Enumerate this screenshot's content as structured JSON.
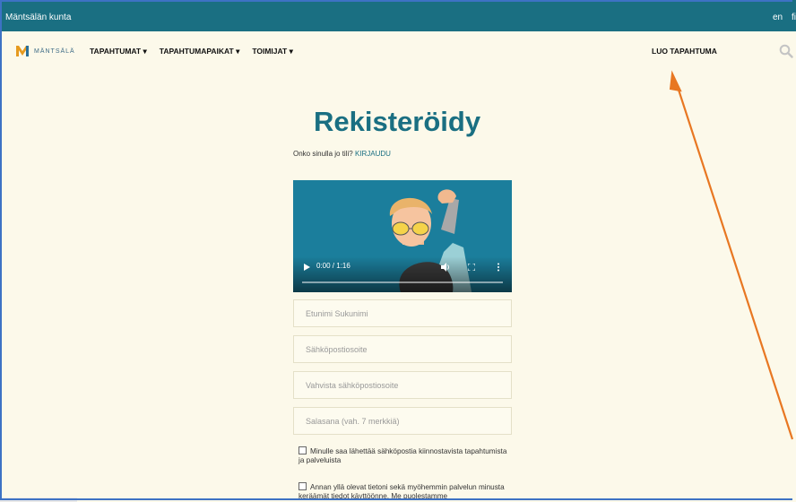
{
  "topbar": {
    "municipality": "Mäntsälän kunta",
    "lang_en": "en",
    "lang_fi": "fi"
  },
  "logo": {
    "text": "MÄNTSÄLÄ"
  },
  "nav": {
    "items": [
      {
        "label": "TAPAHTUMAT ▾"
      },
      {
        "label": "TAPAHTUMAPAIKAT ▾"
      },
      {
        "label": "TOIMIJAT ▾"
      }
    ],
    "create_event": "LUO TAPAHTUMA"
  },
  "page": {
    "title": "Rekisteröidy",
    "login_prompt": "Onko sinulla jo tili?",
    "login_link": "KIRJAUDU"
  },
  "video": {
    "time": "0:00 / 1:16",
    "progress": 0
  },
  "form": {
    "name_placeholder": "Etunimi Sukunimi",
    "email_placeholder": "Sähköpostiosoite",
    "email_confirm_placeholder": "Vahvista sähköpostiosoite",
    "password_placeholder": "Salasana (vah. 7 merkkiä)",
    "consent_marketing": "Minulle saa lähettää sähköpostia kiinnostavista tapahtumista ja palveluista",
    "consent_data": "Annan yllä olevat tietoni sekä myöhemmin palvelun minusta keräämät tiedot käyttöönne. Me puolestamme"
  },
  "colors": {
    "topbar": "#1a6f82",
    "background": "#fcf9ea",
    "accent": "#1a6f82",
    "arrow": "#e87722"
  }
}
